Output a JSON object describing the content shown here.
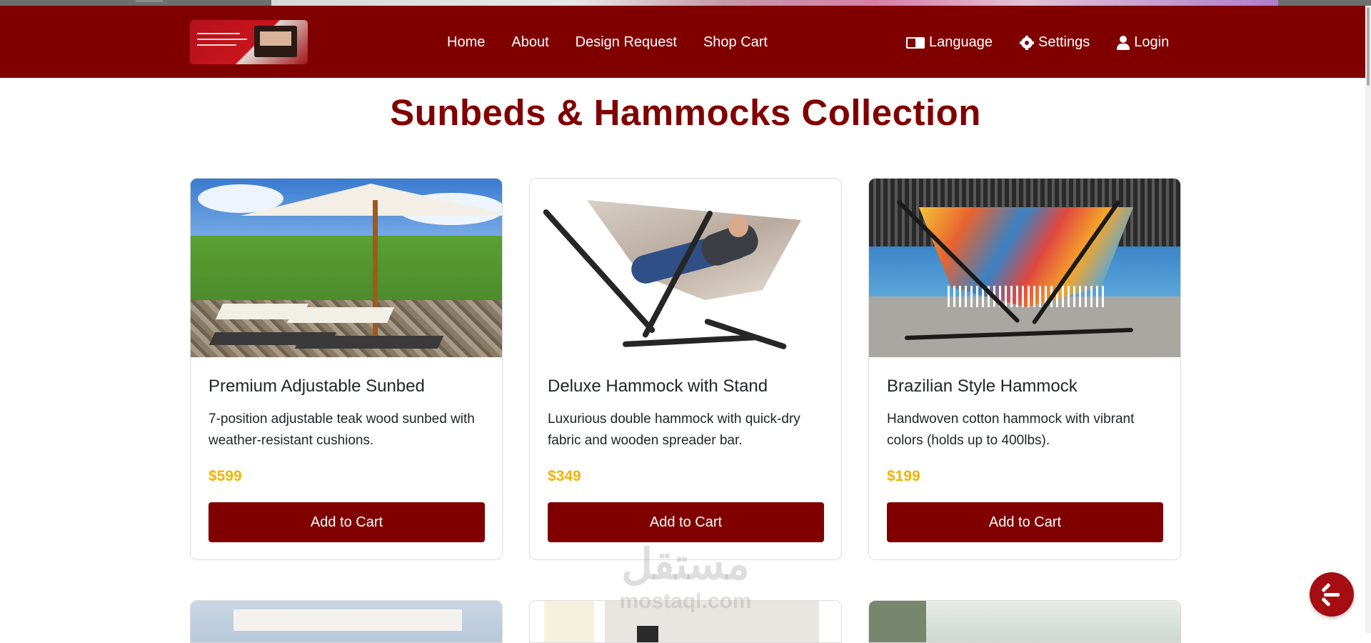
{
  "nav": {
    "links": [
      "Home",
      "About",
      "Design Request",
      "Shop Cart"
    ],
    "language": "Language",
    "settings": "Settings",
    "login": "Login"
  },
  "page": {
    "title": "Sunbeds & Hammocks Collection"
  },
  "products": [
    {
      "name": "Premium Adjustable Sunbed",
      "description": "7-position adjustable teak wood sunbed with weather-resistant cushions.",
      "price": "$599",
      "button": "Add to Cart"
    },
    {
      "name": "Deluxe Hammock with Stand",
      "description": "Luxurious double hammock with quick-dry fabric and wooden spreader bar.",
      "price": "$349",
      "button": "Add to Cart"
    },
    {
      "name": "Brazilian Style Hammock",
      "description": "Handwoven cotton hammock with vibrant colors (holds up to 400lbs).",
      "price": "$199",
      "button": "Add to Cart"
    }
  ],
  "watermark": {
    "arabic": "مستقل",
    "latin": "mostaql.com"
  },
  "colors": {
    "brand": "#800000",
    "price": "#f0b400",
    "fab": "#a50d12"
  },
  "icons": {
    "language": "language-icon",
    "settings": "gear-icon",
    "login": "user-icon",
    "back": "arrow-left-icon"
  }
}
